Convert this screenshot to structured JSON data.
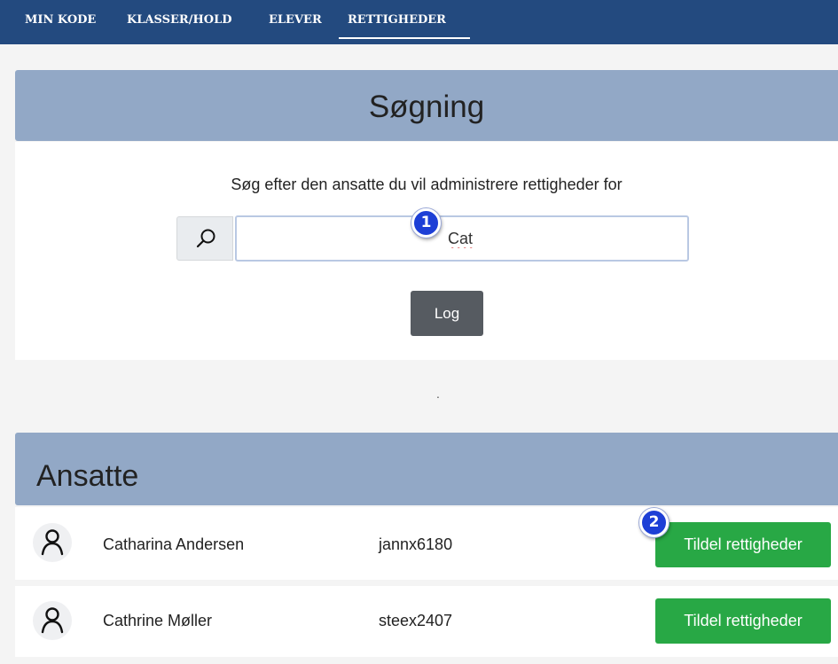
{
  "nav": {
    "items": [
      {
        "label": "MIN KODE"
      },
      {
        "label": "KLASSER/HOLD"
      },
      {
        "label": "ELEVER"
      },
      {
        "label": "RETTIGHEDER",
        "active": true
      }
    ]
  },
  "search": {
    "title": "Søgning",
    "instruction": "Søg efter den ansatte du vil administrere rettigheder for",
    "input_value": "Cat",
    "log_label": "Log"
  },
  "separator_text": ".",
  "employees": {
    "title": "Ansatte",
    "rows": [
      {
        "name": "Catharina Andersen",
        "username": "jannx6180",
        "action_label": "Tildel rettigheder"
      },
      {
        "name": "Cathrine Møller",
        "username": "steex2407",
        "action_label": "Tildel rettigheder"
      }
    ]
  },
  "annotations": {
    "step1": "1",
    "step2": "2"
  },
  "colors": {
    "navbar": "#234a7f",
    "section_header": "#92a8c6",
    "log_button": "#565b61",
    "grant_button": "#28a845",
    "annotation_badge": "#1d3fd6"
  },
  "icons": {
    "search": "search-icon",
    "user": "user-icon"
  }
}
